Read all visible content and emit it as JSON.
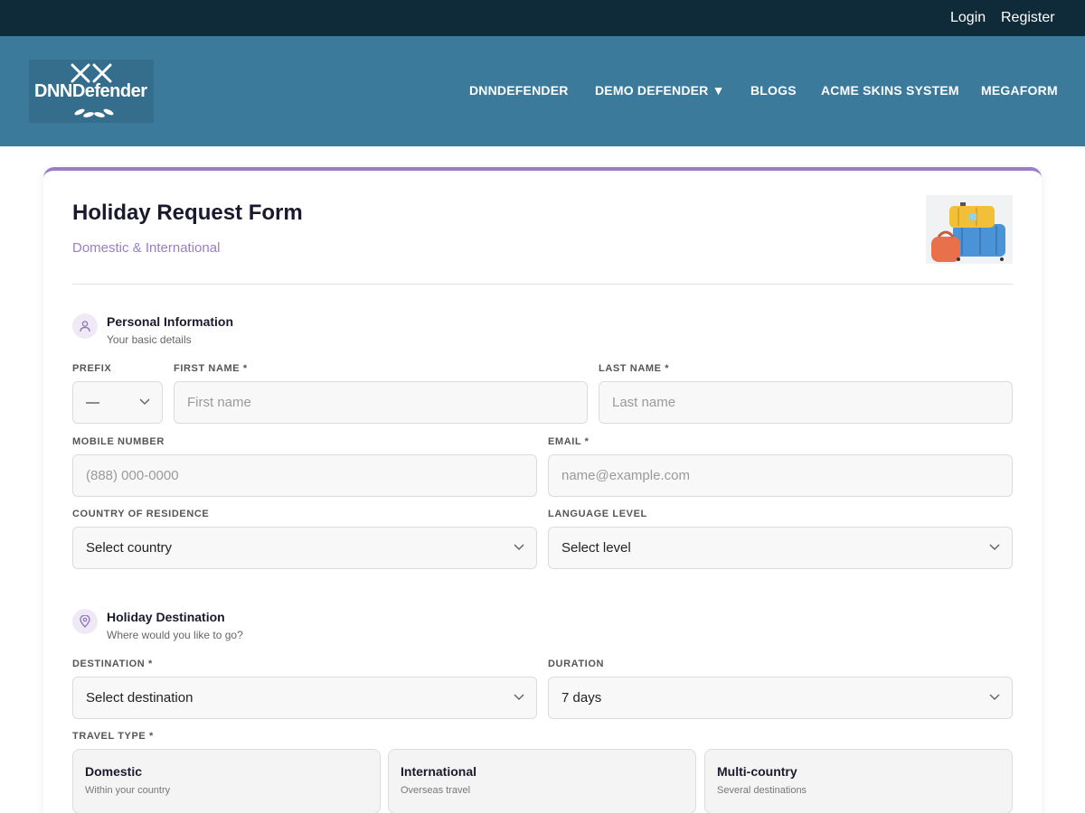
{
  "topbar": {
    "login": "Login",
    "register": "Register"
  },
  "header": {
    "logo_text": "DNNDefender",
    "nav": [
      "DNNDEFENDER",
      "DEMO DEFENDER ▼",
      "BLOGS",
      "ACME SKINS SYSTEM",
      "MEGAFORM"
    ]
  },
  "form": {
    "title": "Holiday Request Form",
    "subtitle": "Domestic & International",
    "personal": {
      "title": "Personal Information",
      "subtitle": "Your basic details",
      "prefix_label": "PREFIX",
      "prefix_value": "—",
      "first_name_label": "FIRST NAME *",
      "first_name_placeholder": "First name",
      "last_name_label": "LAST NAME *",
      "last_name_placeholder": "Last name",
      "mobile_label": "MOBILE NUMBER",
      "mobile_placeholder": "(888) 000-0000",
      "email_label": "EMAIL *",
      "email_placeholder": "name@example.com",
      "country_label": "COUNTRY OF RESIDENCE",
      "country_value": "Select country",
      "language_label": "LANGUAGE LEVEL",
      "language_value": "Select level"
    },
    "destination": {
      "title": "Holiday Destination",
      "subtitle": "Where would you like to go?",
      "destination_label": "DESTINATION *",
      "destination_value": "Select destination",
      "duration_label": "DURATION",
      "duration_value": "7 days",
      "travel_type_label": "TRAVEL TYPE *",
      "travel_types": [
        {
          "title": "Domestic",
          "sub": "Within your country"
        },
        {
          "title": "International",
          "sub": "Overseas travel"
        },
        {
          "title": "Multi-country",
          "sub": "Several destinations"
        }
      ]
    }
  },
  "colors": {
    "topbar": "#0f2b3a",
    "header": "#3c7a9b",
    "accent": "#9b7cc8",
    "field_bg": "#f8f8f8"
  }
}
